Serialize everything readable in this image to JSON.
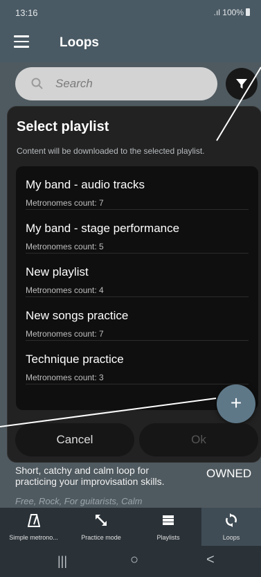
{
  "status_bar": {
    "time": "13:16",
    "signal": ".ıl",
    "battery_pct": "100%"
  },
  "app_bar": {
    "title": "Loops"
  },
  "search": {
    "placeholder": "Search"
  },
  "dialog": {
    "title": "Select playlist",
    "subtitle": "Content will be downloaded to the selected playlist.",
    "playlists": [
      {
        "name": "My band - audio tracks",
        "count_text": "Metronomes count: 7"
      },
      {
        "name": "My band - stage performance",
        "count_text": "Metronomes count: 5"
      },
      {
        "name": "New playlist",
        "count_text": "Metronomes count: 4"
      },
      {
        "name": "New songs practice",
        "count_text": "Metronomes count: 7"
      },
      {
        "name": "Technique practice",
        "count_text": "Metronomes count: 3"
      }
    ],
    "fab_label": "+",
    "cancel_label": "Cancel",
    "ok_label": "Ok"
  },
  "loop_card": {
    "description": "Short, catchy and calm loop for practicing your improvisation skills.",
    "status": "OWNED",
    "tags": "Free, Rock, For guitarists, Calm"
  },
  "bottom_nav": {
    "items": [
      {
        "label": "Simple metrono...",
        "icon": "metronome-icon"
      },
      {
        "label": "Practice mode",
        "icon": "practice-icon"
      },
      {
        "label": "Playlists",
        "icon": "playlist-icon"
      },
      {
        "label": "Loops",
        "icon": "loops-icon",
        "active": true
      }
    ]
  },
  "system_nav": {
    "recents": "|||",
    "home": "○",
    "back": "<"
  },
  "colors": {
    "app_bar": "#4a5a64",
    "fab": "#5e7888",
    "sheet": "#222222",
    "list_bg": "#0f0f0f"
  }
}
